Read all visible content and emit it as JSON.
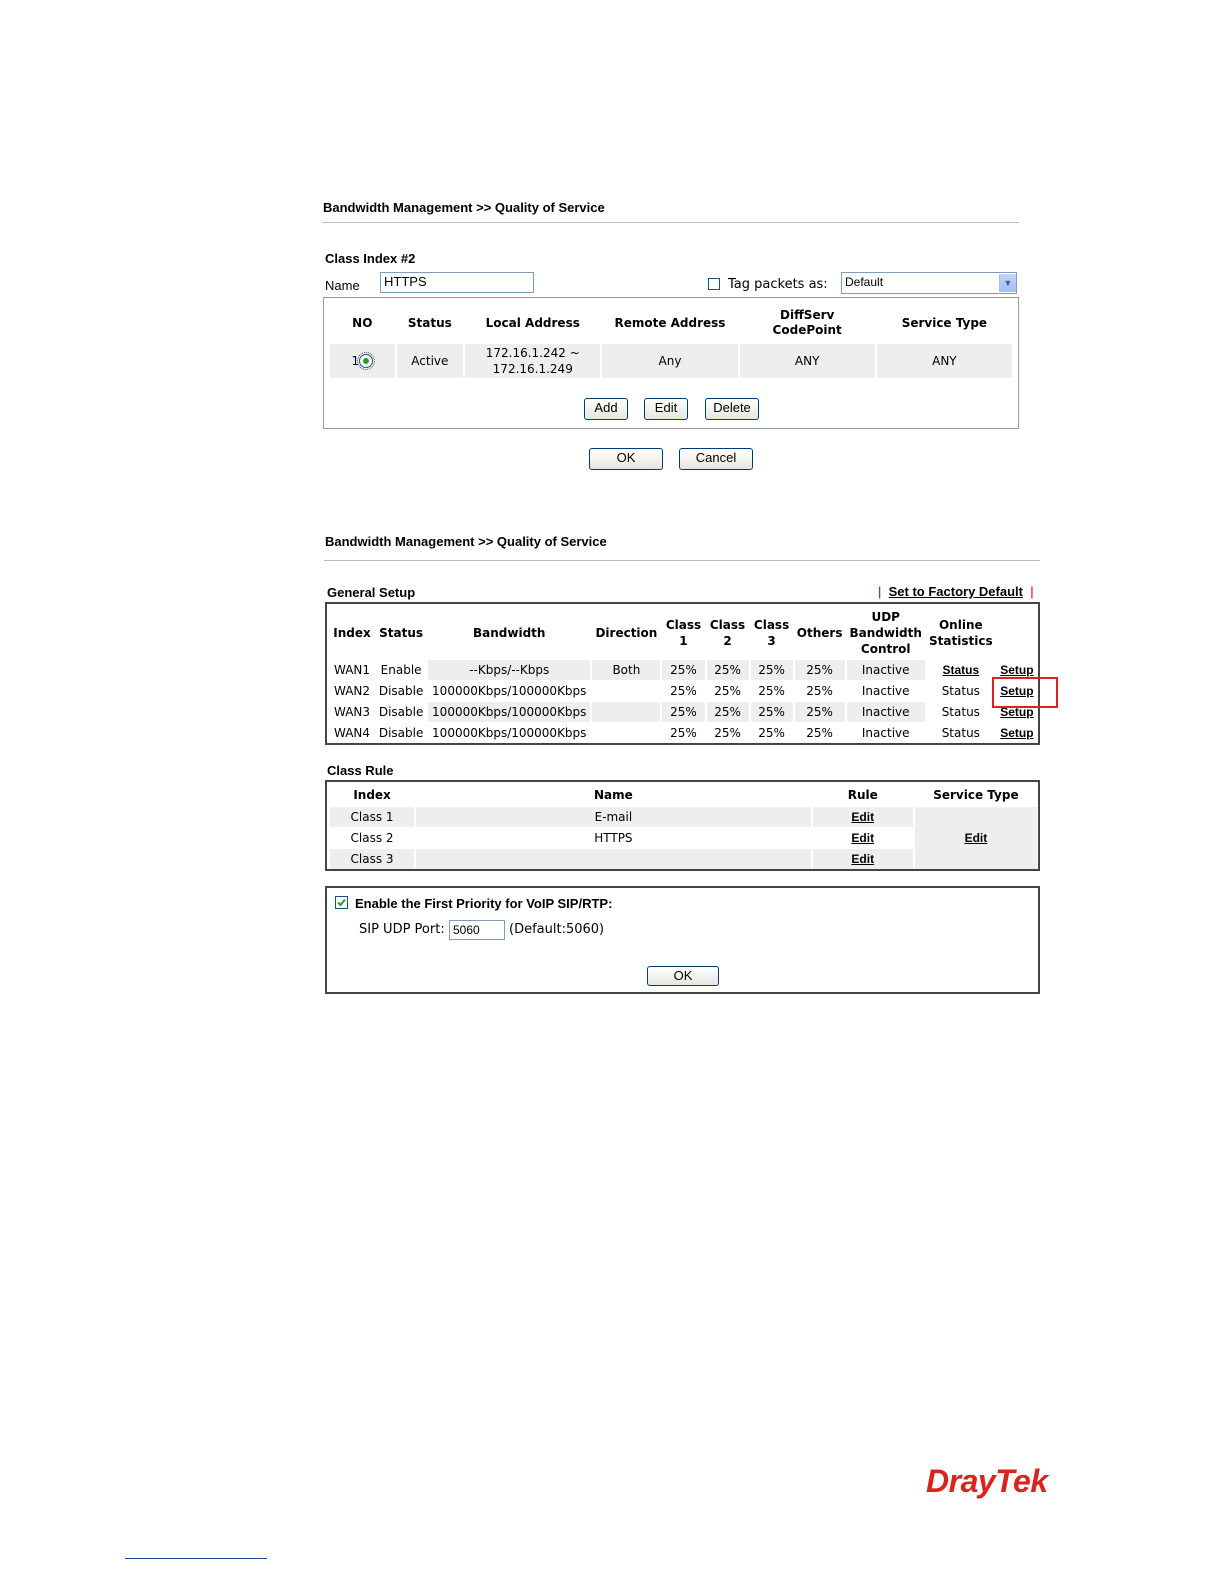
{
  "screen1": {
    "title": "Bandwidth Management >> Quality of Service",
    "class_index_label": "Class Index #2",
    "name_label": "Name",
    "name_value": "HTTPS",
    "tag_label": "Tag packets as:",
    "tag_value": "Default",
    "columns": [
      "NO",
      "Status",
      "Local Address",
      "Remote Address",
      "DiffServ CodePoint",
      "Service Type"
    ],
    "rows": [
      {
        "no": "1",
        "status": "Active",
        "local_line1": "172.16.1.242 ~",
        "local_line2": "172.16.1.249",
        "remote": "Any",
        "diffserv": "ANY",
        "service": "ANY"
      }
    ],
    "buttons": {
      "add": "Add",
      "edit": "Edit",
      "delete": "Delete",
      "ok": "OK",
      "cancel": "Cancel"
    }
  },
  "screen2": {
    "title": "Bandwidth Management >> Quality of Service",
    "general_setup_label": "General Setup",
    "factory_default": "Set to Factory Default",
    "general_columns": {
      "index": "Index",
      "status": "Status",
      "bandwidth": "Bandwidth",
      "direction": "Direction",
      "class1_a": "Class",
      "class1_b": "1",
      "class2_a": "Class",
      "class2_b": "2",
      "class3_a": "Class",
      "class3_b": "3",
      "others": "Others",
      "udp_a": "UDP",
      "udp_b": "Bandwidth",
      "udp_c": "Control",
      "online_a": "Online",
      "online_b": "Statistics"
    },
    "wan_rows": [
      {
        "index": "WAN1",
        "status": "Enable",
        "bandwidth": "--Kbps/--Kbps",
        "direction": "Both",
        "c1": "25%",
        "c2": "25%",
        "c3": "25%",
        "others": "25%",
        "udp": "Inactive",
        "stats": "Status",
        "setup": "Setup"
      },
      {
        "index": "WAN2",
        "status": "Disable",
        "bandwidth": "100000Kbps/100000Kbps",
        "direction": "",
        "c1": "25%",
        "c2": "25%",
        "c3": "25%",
        "others": "25%",
        "udp": "Inactive",
        "stats": "Status",
        "setup": "Setup"
      },
      {
        "index": "WAN3",
        "status": "Disable",
        "bandwidth": "100000Kbps/100000Kbps",
        "direction": "",
        "c1": "25%",
        "c2": "25%",
        "c3": "25%",
        "others": "25%",
        "udp": "Inactive",
        "stats": "Status",
        "setup": "Setup"
      },
      {
        "index": "WAN4",
        "status": "Disable",
        "bandwidth": "100000Kbps/100000Kbps",
        "direction": "",
        "c1": "25%",
        "c2": "25%",
        "c3": "25%",
        "others": "25%",
        "udp": "Inactive",
        "stats": "Status",
        "setup": "Setup"
      }
    ],
    "class_rule_label": "Class Rule",
    "class_columns": {
      "index": "Index",
      "name": "Name",
      "rule": "Rule",
      "service": "Service Type"
    },
    "class_rows": [
      {
        "index": "Class 1",
        "name": "E-mail",
        "rule": "Edit"
      },
      {
        "index": "Class 2",
        "name": "HTTPS",
        "rule": "Edit"
      },
      {
        "index": "Class 3",
        "name": "",
        "rule": "Edit"
      }
    ],
    "service_type_edit": "Edit",
    "voip_label": "Enable the First Priority for VoIP SIP/RTP:",
    "sip_port_label": "SIP UDP Port:",
    "sip_port_value": "5060",
    "sip_default": "(Default:5060)",
    "ok": "OK"
  },
  "logo": "DrayTek",
  "colors": {
    "highlight": "#e02020",
    "logo": "#d8231f",
    "footer_link": "#1f3f9f"
  }
}
